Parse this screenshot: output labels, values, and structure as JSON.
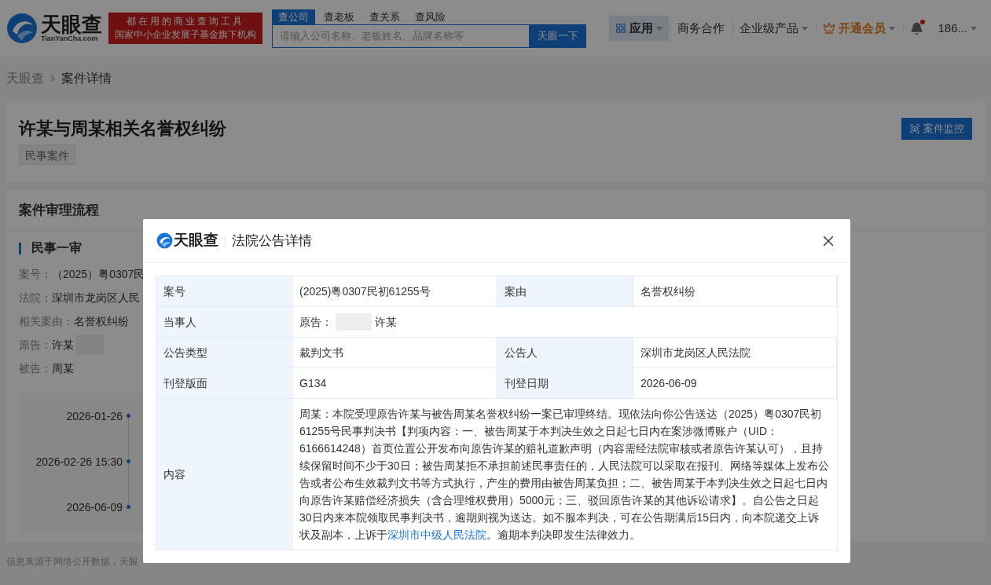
{
  "header": {
    "logo_text": "天眼查",
    "logo_domain": "TianYanCha.com",
    "slogan": [
      "都在用的商业查询工具",
      "国家中小企业发展子基金旗下机构"
    ],
    "search_tabs": [
      {
        "label": "查公司",
        "selected": true
      },
      {
        "label": "查老板",
        "selected": false
      },
      {
        "label": "查关系",
        "selected": false
      },
      {
        "label": "查风险",
        "selected": false
      }
    ],
    "search_placeholder": "请输入公司名称、老板姓名、品牌名称等",
    "search_button": "天眼一下",
    "nav": [
      {
        "kind": "apps",
        "label": "应用",
        "dropdown": true
      },
      {
        "kind": "plain",
        "label": "商务合作",
        "dropdown": false
      },
      {
        "kind": "plain",
        "label": "企业级产品",
        "dropdown": true
      },
      {
        "kind": "vip",
        "label": "开通会员",
        "dropdown": true
      },
      {
        "kind": "bell",
        "unread": true
      },
      {
        "kind": "user",
        "label": "186...",
        "dropdown": true
      }
    ]
  },
  "breadcrumb": [
    "天眼查",
    "案件详情"
  ],
  "case": {
    "title": "许某与周某相关名誉权纠纷",
    "tag": "民事案件",
    "monitor_button": "案件监控"
  },
  "process": {
    "heading": "案件审理流程",
    "stage": "民事一审",
    "fields": [
      {
        "kind": "plain",
        "label": "案号：",
        "value": "（2025）粤0307民"
      },
      {
        "kind": "plain",
        "label": "法院：",
        "value": "深圳市龙岗区人民"
      },
      {
        "kind": "plain",
        "label": "相关案由：",
        "value": "名誉权纠纷"
      },
      {
        "kind": "redacted",
        "label": "原告：",
        "value": "许某"
      },
      {
        "kind": "plain",
        "label": "被告：",
        "value": "周某"
      }
    ],
    "timeline": [
      "2026-01-26",
      "2026-02-26 15:30",
      "2026-06-09"
    ]
  },
  "footer": "信息来源于网络公开数据，天眼",
  "dialog": {
    "logo_text": "天眼查",
    "title": "法院公告详情",
    "rows": [
      {
        "kind": "pair",
        "cells": [
          {
            "label": "案号",
            "value": "(2025)粤0307民初61255号"
          },
          {
            "label": "案由",
            "value": "名誉权纠纷"
          }
        ]
      },
      {
        "kind": "party",
        "label": "当事人",
        "role": "原告：",
        "redacted": true,
        "name": "许某"
      },
      {
        "kind": "pair",
        "cells": [
          {
            "label": "公告类型",
            "value": "裁判文书"
          },
          {
            "label": "公告人",
            "value": "深圳市龙岗区人民法院"
          }
        ]
      },
      {
        "kind": "pair",
        "cells": [
          {
            "label": "刊登版面",
            "value": "G134"
          },
          {
            "label": "刊登日期",
            "value": "2026-06-09"
          }
        ]
      },
      {
        "kind": "content",
        "label": "内容",
        "text_before": "周某：本院受理原告许某与被告周某名誉权纠纷一案已审理终结。现依法向你公告送达（2025）粤0307民初61255号民事判决书【判项内容：一、被告周某于本判决生效之日起七日内在案涉微博账户（UID：6166614248）首页位置公开发布向原告许某的赔礼道歉声明（内容需经法院审核或者原告许某认可），且持续保留时间不少于30日；被告周某拒不承担前述民事责任的，人民法院可以采取在报刊、网络等媒体上发布公告或者公布生效裁判文书等方式执行，产生的费用由被告周某负担；二、被告周某于本判决生效之日起七日内向原告许某赔偿经济损失（含合理维权费用）5000元；三、驳回原告许某的其他诉讼请求】。自公告之日起30日内来本院领取民事判决书，逾期则视为送达。如不服本判决，可在公告期满后15日内，向本院递交上诉状及副本，上诉于",
        "link": "深圳市中级人民法院",
        "text_after": "。逾期本判决即发生法律效力。"
      }
    ]
  }
}
